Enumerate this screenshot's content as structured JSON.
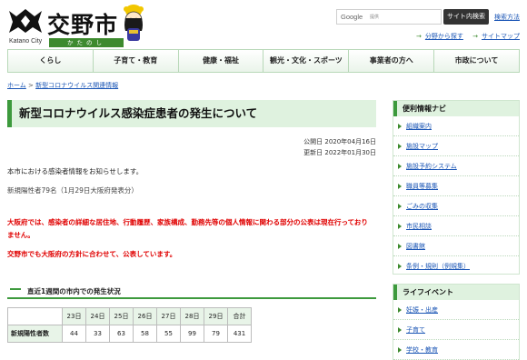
{
  "header": {
    "site_title": "交野市",
    "site_en": "Katano City",
    "site_kana": "かたのし",
    "search": {
      "engine_label": "Google",
      "sub_label": "提供",
      "button_label": "サイト内検索",
      "help_label": "検索方法"
    },
    "util_links": [
      "分野から探す",
      "サイトマップ"
    ]
  },
  "nav": {
    "items": [
      "くらし",
      "子育て・教育",
      "健康・福祉",
      "観光・文化・スポーツ",
      "事業者の方へ",
      "市政について"
    ]
  },
  "breadcrumb": {
    "home": "ホーム",
    "separator": ">",
    "current": "新型コロナウイルス関連情報"
  },
  "main": {
    "title": "新型コロナウイルス感染症患者の発生について",
    "published": "公開日 2020年04月16日",
    "updated": "更新日 2022年01月30日",
    "intro": "本市における感染者情報をお知らせします。",
    "new_cases": "新規陽性者79名（1月29日大阪府発表分）",
    "notice_1": "大阪府では、感染者の詳細な居住地、行動履歴、家族構成、勤務先等の個人情報に関わる部分の公表は現在行っておりません。",
    "notice_2": "交野市でも大阪府の方針に合わせて、公表しています。",
    "table_heading": "直近1週間の市内での発生状況",
    "table": {
      "days": [
        "23日",
        "24日",
        "25日",
        "26日",
        "27日",
        "28日",
        "29日",
        "合計"
      ],
      "row_label": "新規陽性者数",
      "values": [
        "44",
        "33",
        "63",
        "58",
        "55",
        "99",
        "79",
        "431"
      ]
    }
  },
  "sidebar": {
    "nav_title": "便利情報ナビ",
    "nav_items": [
      "組織案内",
      "施設マップ",
      "施設予約システム",
      "職員等募集",
      "ごみの収集",
      "市民相談",
      "図書館",
      "条例・規則（例規集）"
    ],
    "life_title": "ライフイベント",
    "life_items": [
      "妊娠・出産",
      "子育て",
      "学校・教育"
    ]
  },
  "colors": {
    "accent_green": "#3d9a3d",
    "link_blue": "#1a55b5",
    "alert_red": "#e00000"
  }
}
